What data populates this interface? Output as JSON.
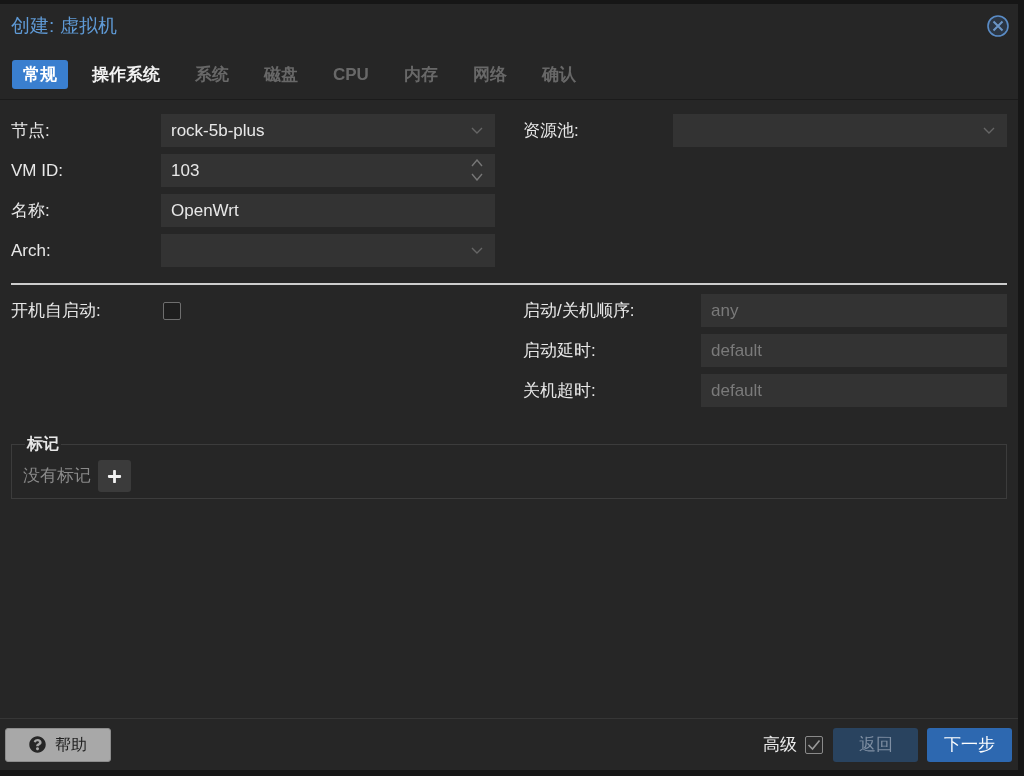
{
  "window": {
    "title": "创建: 虚拟机"
  },
  "tabs": [
    {
      "label": "常规",
      "selected": true,
      "disabled": false
    },
    {
      "label": "操作系统",
      "selected": false,
      "disabled": false
    },
    {
      "label": "系统",
      "selected": false,
      "disabled": true
    },
    {
      "label": "磁盘",
      "selected": false,
      "disabled": true
    },
    {
      "label": "CPU",
      "selected": false,
      "disabled": true
    },
    {
      "label": "内存",
      "selected": false,
      "disabled": true
    },
    {
      "label": "网络",
      "selected": false,
      "disabled": true
    },
    {
      "label": "确认",
      "selected": false,
      "disabled": true
    }
  ],
  "general": {
    "left_fields": [
      {
        "kind": "combobox",
        "label": "节点:",
        "value": "rock-5b-plus"
      },
      {
        "kind": "spinner",
        "label": "VM ID:",
        "value": "103"
      },
      {
        "kind": "text",
        "label": "名称:",
        "value": "OpenWrt"
      },
      {
        "kind": "combobox",
        "label": "Arch:"
      }
    ],
    "right_fields": [
      {
        "kind": "combobox",
        "label": "资源池:"
      }
    ]
  },
  "startup": {
    "autostart": {
      "label": "开机自启动:",
      "checked": false
    },
    "fields": [
      {
        "kind": "text",
        "label": "启动/关机顺序:",
        "placeholder": "any"
      },
      {
        "kind": "text",
        "label": "启动延时:",
        "placeholder": "default"
      },
      {
        "kind": "text",
        "label": "关机超时:",
        "placeholder": "default"
      }
    ]
  },
  "tags": {
    "legend": "标记",
    "empty_text": "没有标记"
  },
  "footer": {
    "help_button": "帮助",
    "advanced": {
      "label": "高级",
      "checked": true
    },
    "buttons": [
      {
        "label": "返回",
        "disabled": true
      },
      {
        "label": "下一步",
        "disabled": false
      }
    ]
  }
}
